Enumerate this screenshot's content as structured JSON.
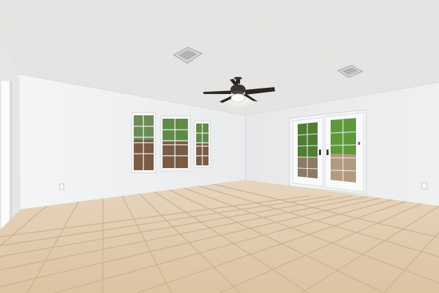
{
  "scene": {
    "kind": "empty-room-interior",
    "elements": {
      "ceiling": {
        "texture": "popcorn",
        "color": "#f1f0ee"
      },
      "ceiling_fan": {
        "blades": 5,
        "light": "on",
        "blade_color": "#2b2724"
      },
      "ceiling_vents": 2,
      "left_wall": {
        "windows": 3,
        "outlet": true
      },
      "right_wall": {
        "door": "french-door-pair",
        "outlet": true
      },
      "floor": {
        "material": "ceramic tile",
        "color": "#dfc8a9",
        "grout": "#c9b08f"
      }
    },
    "colors": {
      "wall": "#eef0f1",
      "ceiling": "#f1f0ee",
      "tile": "#dfc8a9",
      "grout": "#c9b08f",
      "glass_green": "#5b8a3a",
      "fan": "#2b2724"
    }
  }
}
